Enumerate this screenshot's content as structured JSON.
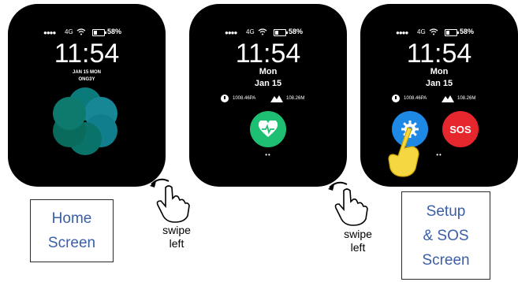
{
  "status_bar": {
    "signal": "●●●●",
    "network": "4G",
    "battery": "58%"
  },
  "screen_home": {
    "time": "11:54",
    "date_line": "JAN 15 MON",
    "sub_line": "ONG3Y"
  },
  "screen_heart": {
    "time": "11:54",
    "day": "Mon",
    "date": "Jan 15",
    "pressure": "1008.46PA",
    "altitude": "108.26M",
    "page_dots": "••"
  },
  "screen_setup": {
    "time": "11:54",
    "day": "Mon",
    "date": "Jan 15",
    "pressure": "1008.46PA",
    "altitude": "108.26M",
    "sos_label": "SOS",
    "page_dots": "••"
  },
  "labels": {
    "home_line1": "Home",
    "home_line2": "Screen",
    "setup_line1": "Setup",
    "setup_line2": "& SOS",
    "setup_line3": "Screen",
    "swipe1_line1": "swipe",
    "swipe1_line2": "left",
    "swipe2_line1": "swipe",
    "swipe2_line2": "left"
  },
  "colors": {
    "heart_button": "#1fbf73",
    "gear_button": "#1e88e5",
    "sos_button": "#e6262d",
    "label_text": "#3a5ea8",
    "flower_teal": "#0fa3a3",
    "tap_hand": "#f5d742"
  },
  "icons": [
    "heart-pulse-icon",
    "gear-icon",
    "tap-hand-icon",
    "swipe-hand-icon",
    "gauge-icon",
    "mountain-icon",
    "wifi-icon",
    "battery-icon",
    "breathe-flower-icon"
  ]
}
